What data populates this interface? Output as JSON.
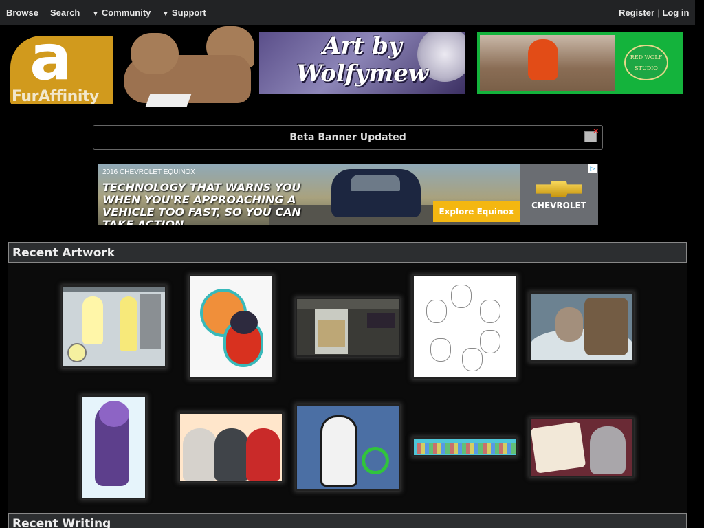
{
  "nav": {
    "browse": "Browse",
    "search": "Search",
    "community": "Community",
    "support": "Support",
    "caret": "▼",
    "register": "Register",
    "separator": "|",
    "login": "Log in"
  },
  "header": {
    "logo_text": "FurAffinity",
    "logo_glyph": "a",
    "banner_line1": "Art by",
    "banner_line2": "Wolfymew",
    "studio_seal_top": "RED WOLF",
    "studio_seal_bottom": "STUDIO"
  },
  "notice": {
    "text": "Beta Banner Updated"
  },
  "ad": {
    "model": "2016 CHEVROLET EQUINOX",
    "headline": "TECHNOLOGY THAT WARNS YOU WHEN YOU'RE APPROACHING A VEHICLE TOO FAST, SO YOU CAN TAKE ACTION.",
    "cta": "Explore Equinox",
    "brand": "CHEVROLET",
    "adchoices": "▷"
  },
  "sections": {
    "recent_artwork": "Recent Artwork",
    "recent_writing": "Recent Writing"
  },
  "colors": {
    "background": "#000000",
    "nav_background": "#222325",
    "section_header": "#2c2e30",
    "accent_logo": "#d19a1d",
    "cta_yellow": "#f4b711"
  }
}
